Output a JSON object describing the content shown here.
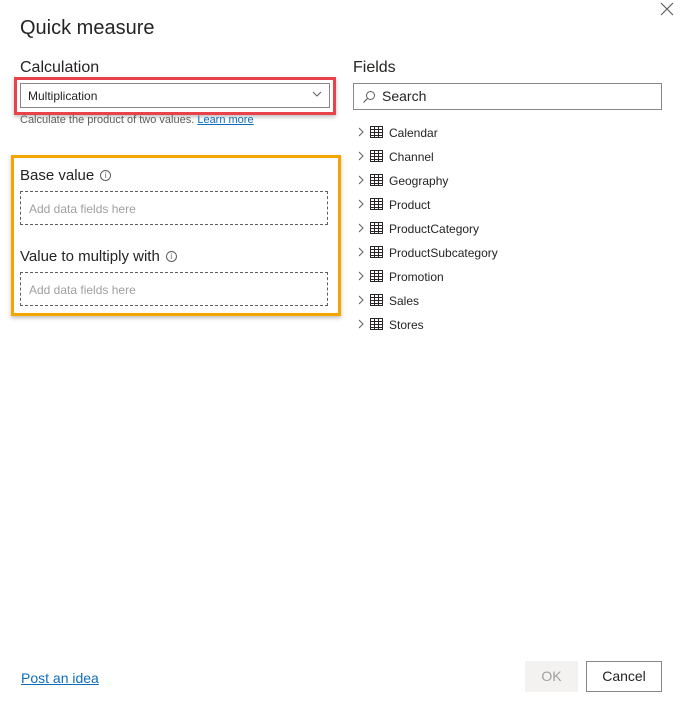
{
  "dialog": {
    "title": "Quick measure",
    "close_icon": "close-icon"
  },
  "calculation": {
    "label": "Calculation",
    "selected": "Multiplication",
    "description": "Calculate the product of two values.",
    "learn_more": "Learn more",
    "highlight_color": "#e8434b"
  },
  "inputs": {
    "highlight_color": "#f5a400",
    "base_value": {
      "label": "Base value",
      "placeholder": "Add data fields here"
    },
    "multiply_value": {
      "label": "Value to multiply with",
      "placeholder": "Add data fields here"
    }
  },
  "fields": {
    "label": "Fields",
    "search_placeholder": "Search",
    "tables": [
      {
        "name": "Calendar"
      },
      {
        "name": "Channel"
      },
      {
        "name": "Geography"
      },
      {
        "name": "Product"
      },
      {
        "name": "ProductCategory"
      },
      {
        "name": "ProductSubcategory"
      },
      {
        "name": "Promotion"
      },
      {
        "name": "Sales"
      },
      {
        "name": "Stores"
      }
    ]
  },
  "footer": {
    "post_idea": "Post an idea",
    "ok": "OK",
    "cancel": "Cancel"
  }
}
